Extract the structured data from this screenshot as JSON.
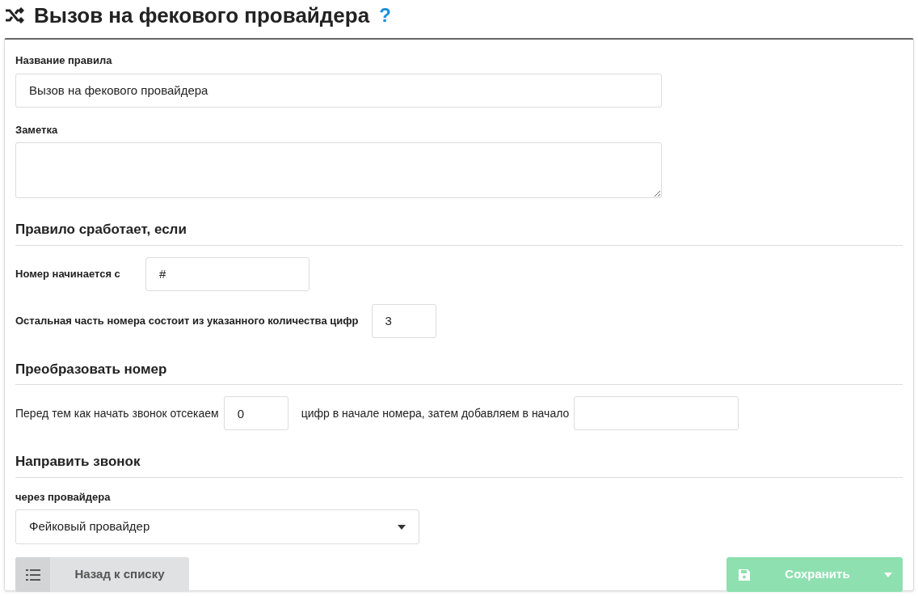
{
  "title": "Вызов на фекового провайдера",
  "help": "?",
  "name_field": {
    "label": "Название правила",
    "value": "Вызов на фекового провайдера"
  },
  "note_field": {
    "label": "Заметка"
  },
  "conditions": {
    "heading": "Правило сработает, если",
    "prefix_label": "Номер начинается с",
    "prefix_value": "#",
    "digits_label": "Остальная часть номера состоит из указанного количества цифр",
    "digits_value": "3"
  },
  "transform": {
    "heading": "Преобразовать номер",
    "text_before": "Перед тем как начать звонок отсекаем",
    "cut_value": "0",
    "text_after": "цифр в начале номера, затем добавляем в начало"
  },
  "route": {
    "heading": "Направить звонок",
    "label": "через провайдера",
    "provider": "Фейковый провайдер"
  },
  "back_button": {
    "label": "Назад к списку"
  },
  "save_button": {
    "label": "Сохранить",
    "disabled": true
  }
}
